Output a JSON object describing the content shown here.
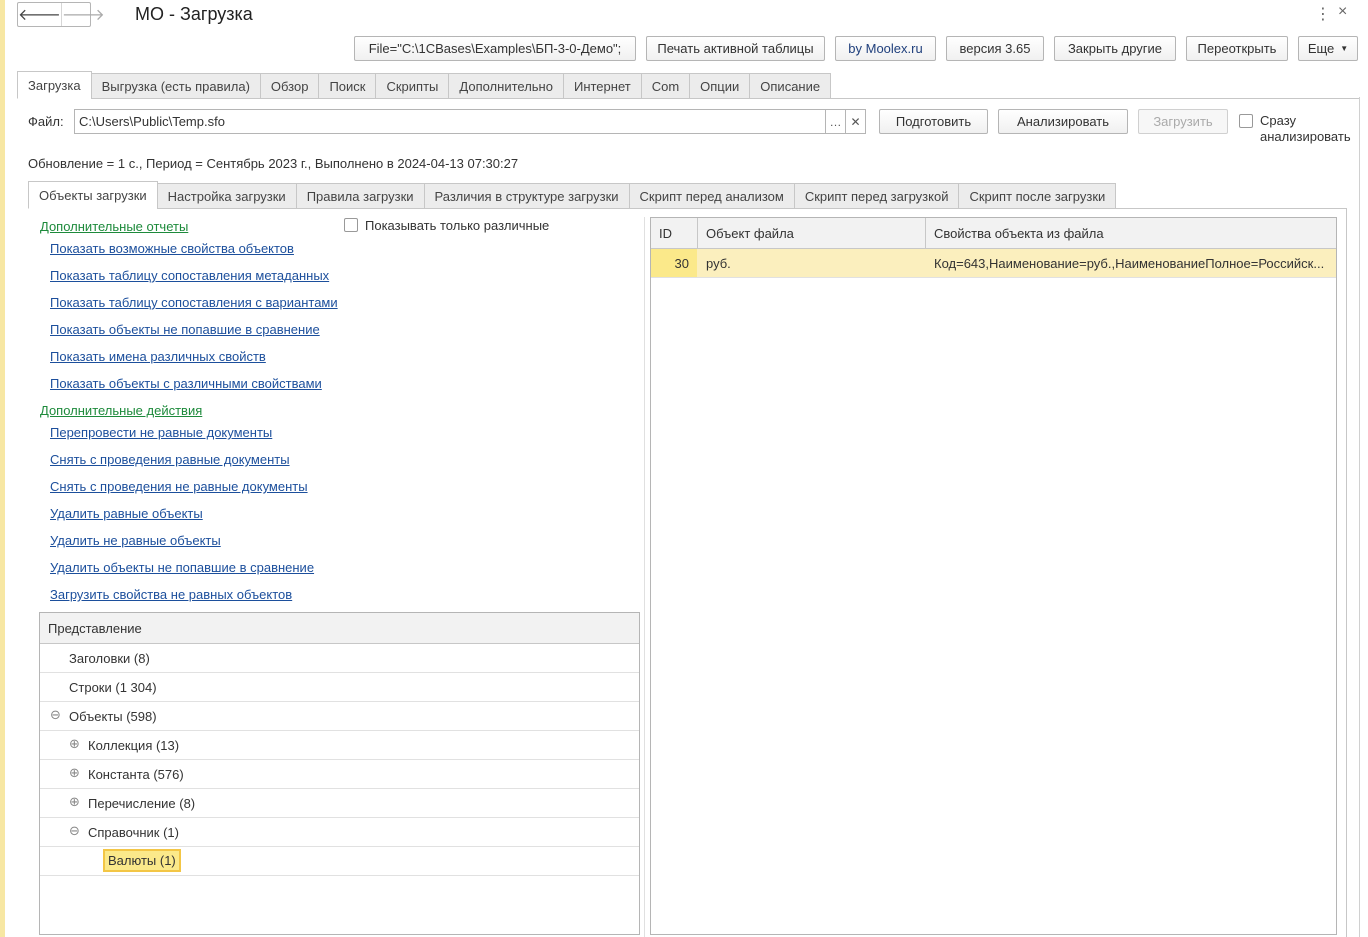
{
  "window": {
    "title": "МО - Загрузка",
    "more_icon": "⋮",
    "close_icon": "×"
  },
  "toolbar": {
    "file_conn": "File=\"C:\\1CBases\\Examples\\БП-3-0-Демо\";",
    "print_table": "Печать активной таблицы",
    "by_moolex": "by Moolex.ru",
    "version": "версия 3.65",
    "close_others": "Закрыть другие",
    "reopen": "Переоткрыть",
    "more": "Еще"
  },
  "main_tabs": [
    "Загрузка",
    "Выгрузка (есть правила)",
    "Обзор",
    "Поиск",
    "Скрипты",
    "Дополнительно",
    "Интернет",
    "Com",
    "Опции",
    "Описание"
  ],
  "file_row": {
    "label": "Файл:",
    "value": "C:\\Users\\Public\\Temp.sfo",
    "prepare": "Подготовить",
    "analyze": "Анализировать",
    "load": "Загрузить",
    "auto_analyze_line1": "Сразу",
    "auto_analyze_line2": "анализировать"
  },
  "status_line": "Обновление = 1 с., Период = Сентябрь 2023 г., Выполнено в 2024-04-13 07:30:27",
  "sub_tabs": [
    "Объекты загрузки",
    "Настройка загрузки",
    "Правила загрузки",
    "Различия в структуре загрузки",
    "Скрипт перед анализом",
    "Скрипт перед загрузкой",
    "Скрипт после загрузки"
  ],
  "reports": {
    "header": "Дополнительные отчеты",
    "show_diff_only": "Показывать только различные",
    "items": [
      "Показать возможные свойства объектов",
      "Показать таблицу сопоставления метаданных",
      "Показать таблицу сопоставления с вариантами",
      "Показать объекты не попавшие в сравнение",
      "Показать имена различных свойств",
      "Показать объекты с различными свойствами"
    ]
  },
  "actions": {
    "header": "Дополнительные действия",
    "items": [
      "Перепровести не равные документы",
      "Снять с проведения равные документы",
      "Снять с проведения не равные документы",
      "Удалить равные объекты",
      "Удалить не равные объекты",
      "Удалить объекты не попавшие  в сравнение",
      "Загрузить свойства не равных объектов"
    ]
  },
  "tree": {
    "header": "Представление",
    "rows": [
      {
        "label": "Заголовки (8)",
        "icon": ""
      },
      {
        "label": "Строки (1 304)",
        "icon": ""
      },
      {
        "label": "Объекты (598)",
        "icon": "⊖"
      },
      {
        "label": "Коллекция (13)",
        "icon": "⊕"
      },
      {
        "label": "Константа (576)",
        "icon": "⊕"
      },
      {
        "label": "Перечисление (8)",
        "icon": "⊕"
      },
      {
        "label": "Справочник (1)",
        "icon": "⊖"
      },
      {
        "label": "Валюты (1)",
        "icon": ""
      }
    ]
  },
  "grid": {
    "columns": [
      "ID",
      "Объект файла",
      "Свойства объекта из файла"
    ],
    "rows": [
      {
        "id": "30",
        "object": "руб.",
        "props": "Код=643,Наименование=руб.,НаименованиеПолное=Российск..."
      }
    ]
  },
  "colors": {
    "accent_yellow": "#fbe98a",
    "link_blue": "#1c4f9c",
    "link_green": "#1d8a3b"
  }
}
